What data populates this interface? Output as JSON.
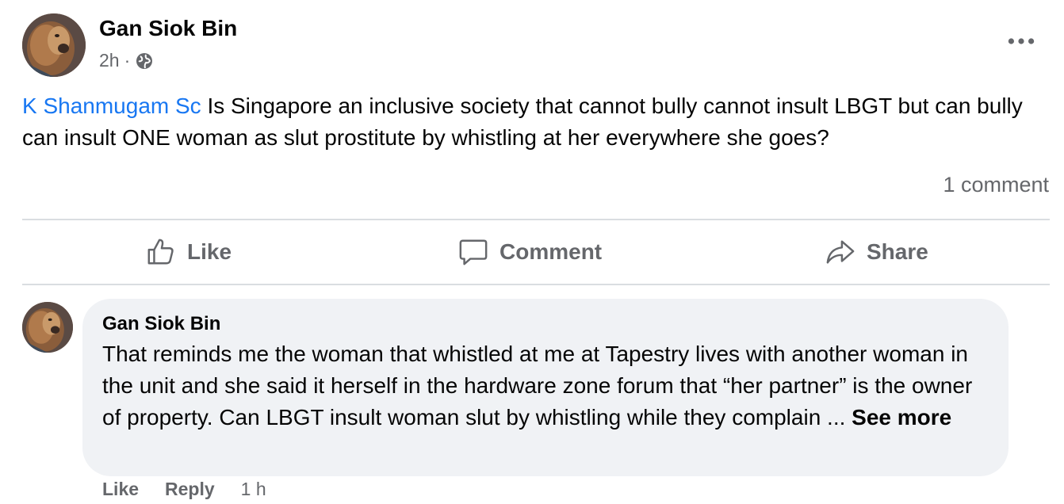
{
  "post": {
    "author": "Gan Siok Bin",
    "time": "2h",
    "separator": "·",
    "privacy_icon": "globe-icon",
    "more_icon": "more-dots-icon",
    "mention": "K Shanmugam Sc",
    "text": " Is Singapore an inclusive society that cannot bully cannot insult LBGT but can bully can insult ONE woman as slut prostitute by whistling at her everywhere she goes?",
    "comment_count": "1 comment"
  },
  "actions": {
    "like": "Like",
    "comment": "Comment",
    "share": "Share"
  },
  "comment": {
    "author": "Gan Siok Bin",
    "text": "That reminds me the woman that whistled at me at Tapestry lives with another woman in the unit and she said it herself in the hardware zone forum that “her partner” is the owner of property. Can LBGT insult woman slut by whistling while they complain ... ",
    "see_more": "See more",
    "like": "Like",
    "reply": "Reply",
    "time": "1 h"
  },
  "colors": {
    "mention": "#1877f2",
    "secondary_text": "#65676b",
    "bubble": "#f0f2f5",
    "divider": "#dadde1"
  }
}
